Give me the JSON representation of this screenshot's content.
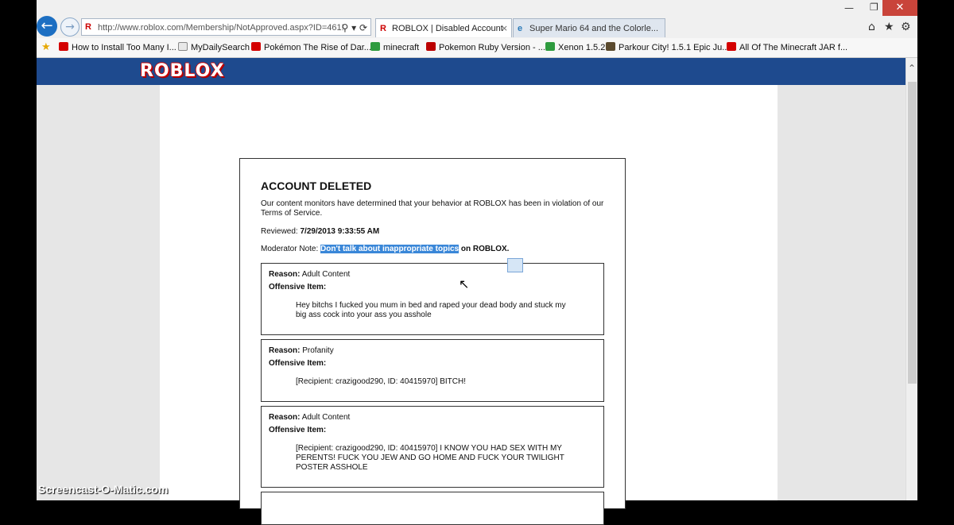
{
  "browser": {
    "url": "http://www.roblox.com/Membership/NotApproved.aspx?ID=461!",
    "tabs": [
      {
        "label": "ROBLOX | Disabled Account",
        "active": true
      },
      {
        "label": "Super Mario 64 and the Colorle...",
        "active": false
      }
    ],
    "favorites": [
      {
        "label": "How to Install Too Many I...",
        "icon": "youtube-icon"
      },
      {
        "label": "MyDailySearch",
        "icon": "page-icon"
      },
      {
        "label": "Pokémon The Rise of Dar...",
        "icon": "youtube-icon"
      },
      {
        "label": "minecraft",
        "icon": "download-icon"
      },
      {
        "label": "Pokemon Ruby Version - ...",
        "icon": "pokeball-icon"
      },
      {
        "label": "Xenon 1.5.2",
        "icon": "download-icon"
      },
      {
        "label": "Parkour City! 1.5.1 Epic Ju...",
        "icon": "minecraft-icon"
      },
      {
        "label": "All Of The Minecraft JAR f...",
        "icon": "youtube-icon"
      }
    ]
  },
  "site": {
    "logo": "ROBLOX"
  },
  "notice": {
    "title": "ACCOUNT DELETED",
    "message": "Our content monitors have determined that your behavior at ROBLOX has been in violation of our Terms of Service.",
    "reviewed_label": "Reviewed:",
    "reviewed_value": "7/29/2013 9:33:55 AM",
    "moderator_label": "Moderator Note:",
    "moderator_highlight": "Don't talk about inappropriate topics",
    "moderator_rest": "on ROBLOX.",
    "reason_label": "Reason:",
    "offensive_label": "Offensive Item:",
    "items": [
      {
        "reason": "Adult Content",
        "text": "Hey bitchs I fucked you mum in bed and raped your dead body and stuck my big ass cock into your ass you asshole"
      },
      {
        "reason": "Profanity",
        "text": "[Recipient: crazigood290, ID: 40415970] BITCH!"
      },
      {
        "reason": "Adult Content",
        "text": "[Recipient: crazigood290, ID: 40415970] I KNOW YOU HAD SEX WITH MY PERENTS! FUCK YOU JEW AND GO HOME AND FUCK YOUR TWILIGHT POSTER ASSHOLE"
      }
    ]
  },
  "watermark": "Screencast-O-Matic.com"
}
